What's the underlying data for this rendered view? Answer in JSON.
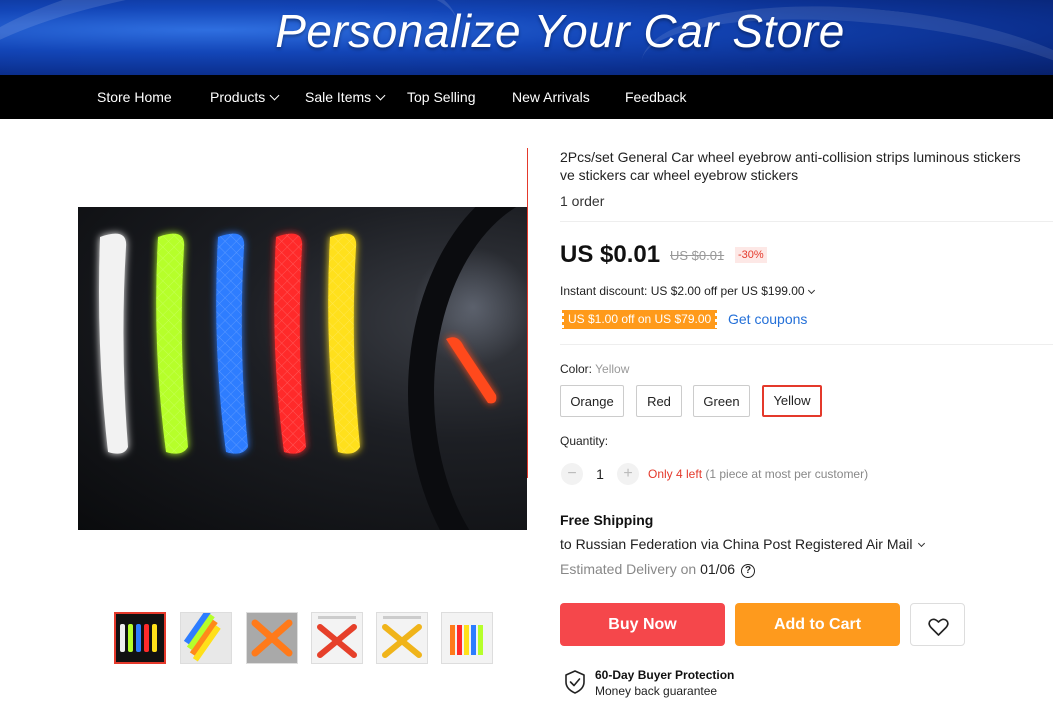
{
  "banner": {
    "title": "Personalize Your Car Store"
  },
  "nav": {
    "items": [
      {
        "label": "Store Home"
      },
      {
        "label": "Products"
      },
      {
        "label": "Sale Items"
      },
      {
        "label": "Top Selling"
      },
      {
        "label": "New Arrivals"
      },
      {
        "label": "Feedback"
      }
    ]
  },
  "product": {
    "title_line1": "2Pcs/set General Car wheel eyebrow anti-collision strips luminous stickers",
    "title_line2": "ve stickers car wheel eyebrow stickers",
    "orders": "1 order",
    "price": "US $0.01",
    "original_price": "US $0.01",
    "discount": "-30%",
    "instant_discount": "Instant discount: US $2.00 off per US $199.00",
    "coupon": "US $1.00 off on US $79.00",
    "get_coupons": "Get coupons"
  },
  "color": {
    "label": "Color:",
    "selected": "Yellow",
    "options": [
      "Orange",
      "Red",
      "Green",
      "Yellow"
    ]
  },
  "quantity": {
    "label": "Quantity:",
    "minus": "−",
    "value": "1",
    "plus": "+",
    "stock": "Only 4 left",
    "note": "(1 piece at most per customer)"
  },
  "shipping": {
    "title": "Free Shipping",
    "to": "to Russian Federation via China Post Registered Air Mail",
    "eta_label": "Estimated Delivery on",
    "eta_date": "01/06"
  },
  "actions": {
    "buy_now": "Buy Now",
    "add_to_cart": "Add to Cart"
  },
  "protection": {
    "title": "60-Day Buyer Protection",
    "subtitle": "Money back guarantee"
  },
  "colors": {
    "accent_red": "#f5474b",
    "accent_orange": "#fe9a1d",
    "link_blue": "#2470d8",
    "strip_colors": [
      "#f4f4f4",
      "#b6ff2a",
      "#2d7dff",
      "#ff2a2a",
      "#ffe01a"
    ]
  },
  "icons": [
    "chevron-down-icon",
    "question-icon",
    "heart-icon",
    "shield-check-icon"
  ]
}
